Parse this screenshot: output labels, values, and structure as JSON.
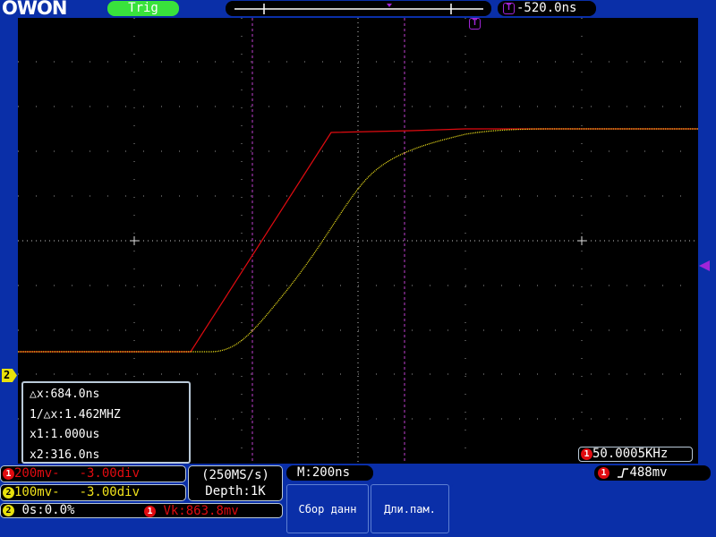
{
  "header": {
    "brand": "OWON",
    "trigger_status": "Trig",
    "trigger_position": "-520.0ns",
    "trigger_icon": "T"
  },
  "channel_marker": "2",
  "cursor_readout": {
    "delta_x": "△x:684.0ns",
    "inv_delta_x": "1/△x:1.462MHZ",
    "x1": "x1:1.000us",
    "x2": "x2:316.0ns"
  },
  "frequency": {
    "badge": "1",
    "value": "50.0005KHz"
  },
  "channels": [
    {
      "badge": "1",
      "scale": "200mv-",
      "offset": "-3.00div",
      "color": "#e10b10"
    },
    {
      "badge": "2",
      "scale": "100mv-",
      "offset": "-3.00div",
      "color": "#f0e21b"
    }
  ],
  "status": {
    "badge": "2",
    "text": "0s:0.0%",
    "vk_badge": "1",
    "vk_text": "Vk:863.8mv"
  },
  "acquisition": {
    "sample_rate": "(250MS/s)",
    "depth": "Depth:1K"
  },
  "timebase": "M:200ns",
  "trigger_level": {
    "badge": "1",
    "slope_icon": "rising-edge-icon",
    "value": "488mv"
  },
  "menu": {
    "items": [
      "Сбор данн",
      "Дли.пам."
    ]
  },
  "colors": {
    "background_ui": "#0a2fa8",
    "screen": "#000000",
    "ch1": "#e10b10",
    "ch2": "#f0e21b",
    "trigger": "#a025d8",
    "accent_green": "#39e23c"
  }
}
